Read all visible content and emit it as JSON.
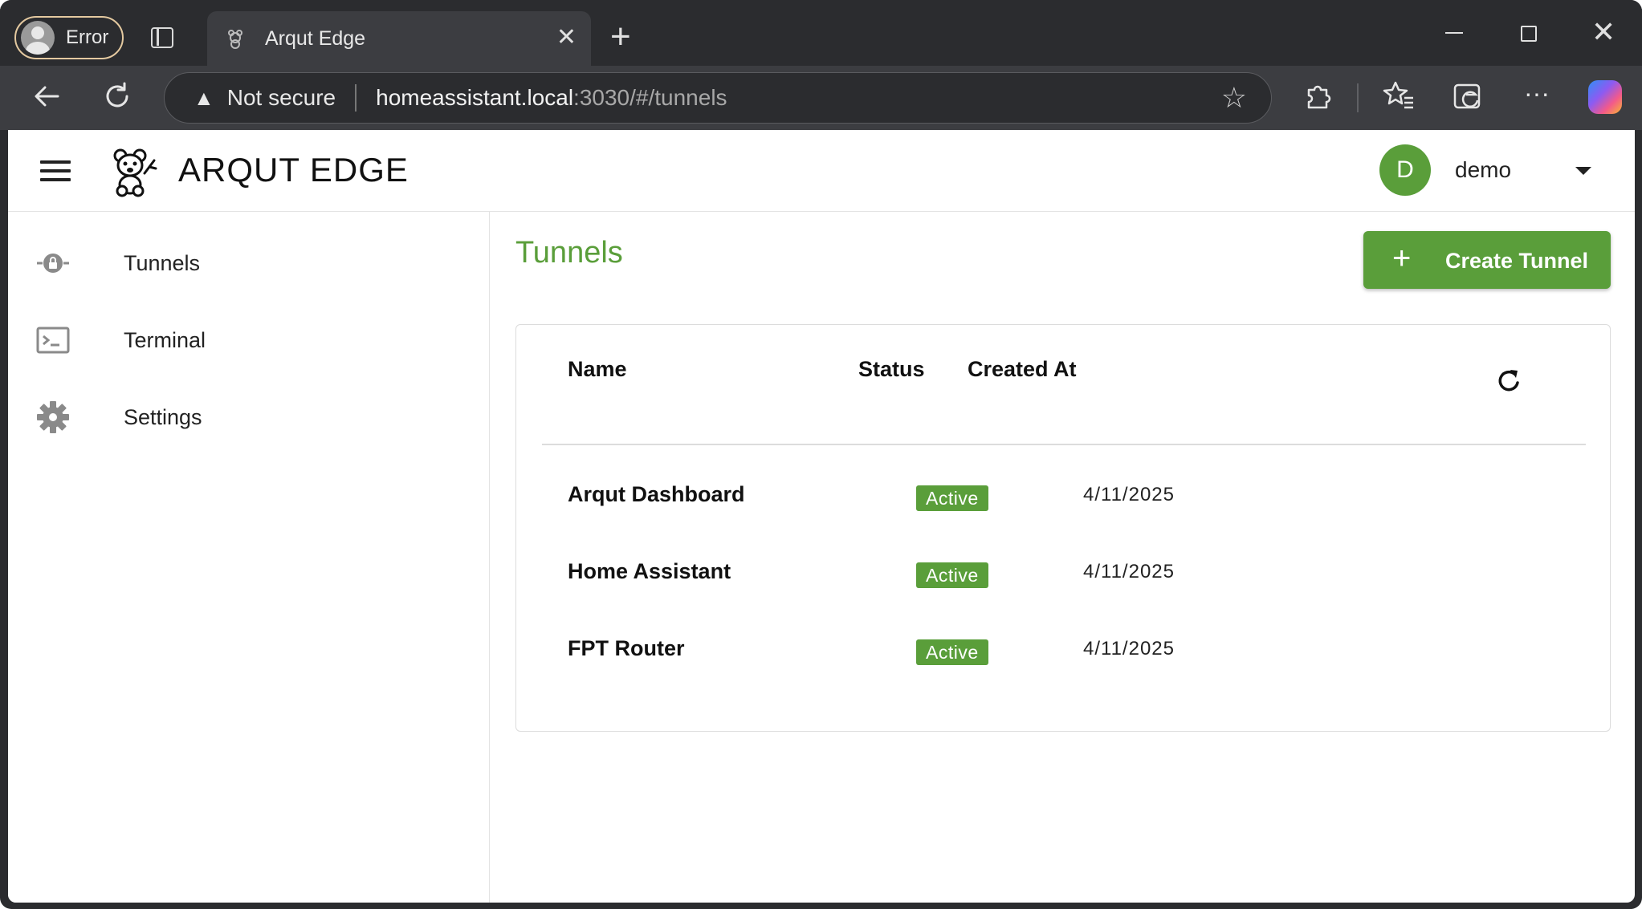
{
  "browser": {
    "profile_label": "Error",
    "tab_title": "Arqut Edge",
    "security_label": "Not secure",
    "url_host": "homeassistant.local",
    "url_rest": ":3030/#/tunnels"
  },
  "app": {
    "brand": "ARQUT EDGE",
    "user_initial": "D",
    "username": "demo"
  },
  "sidebar": {
    "items": [
      {
        "label": "Tunnels",
        "icon": "tunnel-lock-icon"
      },
      {
        "label": "Terminal",
        "icon": "terminal-icon"
      },
      {
        "label": "Settings",
        "icon": "gear-icon"
      }
    ]
  },
  "main": {
    "title": "Tunnels",
    "create_label": "Create Tunnel",
    "columns": [
      "Name",
      "Status",
      "Created At"
    ],
    "rows": [
      {
        "name": "Arqut Dashboard",
        "status": "Active",
        "created": "4/11/2025"
      },
      {
        "name": "Home Assistant",
        "status": "Active",
        "created": "4/11/2025"
      },
      {
        "name": "FPT Router",
        "status": "Active",
        "created": "4/11/2025"
      }
    ]
  },
  "colors": {
    "accent": "#5a9e3a",
    "chrome_dark": "#2b2c2f",
    "chrome_toolbar": "#3c3d41"
  }
}
